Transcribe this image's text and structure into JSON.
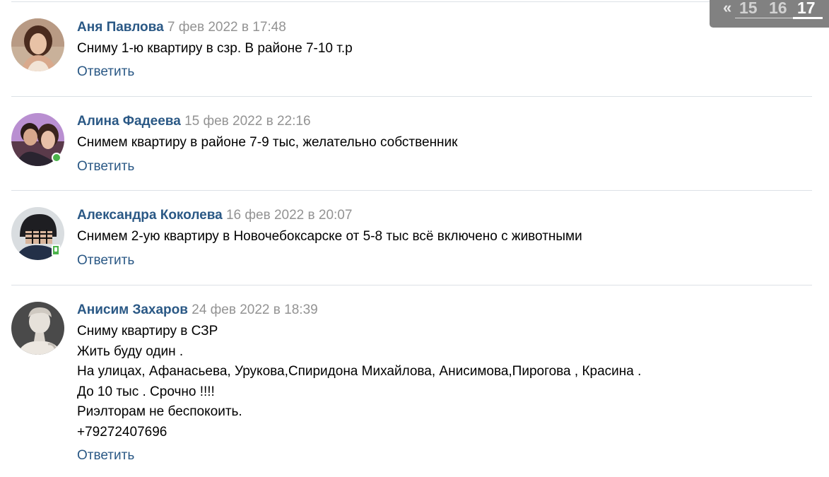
{
  "pagination": {
    "prev_label": "«",
    "pages": [
      "15",
      "16",
      "17"
    ],
    "current": "17"
  },
  "comments": [
    {
      "author": "Аня Павлова",
      "date": "7 фев 2022 в 17:48",
      "lines": [
        "Сниму 1-ю квартиру в сзр. В районе 7-10 т.р"
      ],
      "reply_label": "Ответить",
      "online": "none"
    },
    {
      "author": "Алина Фадеева",
      "date": "15 фев 2022 в 22:16",
      "lines": [
        "Снимем квартиру в районе 7-9 тыс, желательно собственник"
      ],
      "reply_label": "Ответить",
      "online": "desktop"
    },
    {
      "author": "Александра Коколева",
      "date": "16 фев 2022 в 20:07",
      "lines": [
        "Снимем 2-ую квартиру в Новочебоксарске от 5-8 тыс всё включено с животными"
      ],
      "reply_label": "Ответить",
      "online": "mobile"
    },
    {
      "author": "Анисим Захаров",
      "date": "24 фев 2022 в 18:39",
      "lines": [
        "Сниму квартиру в СЗР",
        "Жить буду один .",
        "На улицах, Афанасьева, Урукова,Спиридона Михайлова, Анисимова,Пирогова , Красина .",
        "До 10 тыс . Срочно !!!!",
        "Риэлторам не беспокоить.",
        "+79272407696"
      ],
      "reply_label": "Ответить",
      "online": "none"
    }
  ],
  "colors": {
    "author": "#2a5885",
    "date": "#939393",
    "reply": "#2a5885",
    "online": "#4bb34b",
    "divider": "#dce1e6",
    "pager_bg": "#818181"
  }
}
